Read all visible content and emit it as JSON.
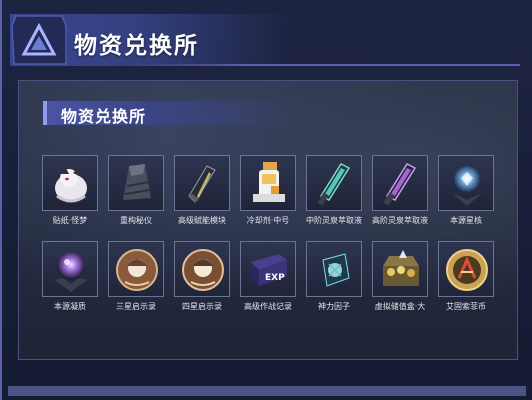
{
  "header": {
    "title": "物资兑换所"
  },
  "panel": {
    "title": "物资兑换所"
  },
  "items_row1": [
    {
      "label": "贴纸·怪梦",
      "icon": "sticker-girl-icon"
    },
    {
      "label": "重构秘仪",
      "icon": "folded-cloth-icon"
    },
    {
      "label": "高级赋能模块",
      "icon": "dark-crystal-module-icon"
    },
    {
      "label": "冷却剂·中号",
      "icon": "coolant-bottle-icon"
    },
    {
      "label": "中阶灵泉萃取液",
      "icon": "teal-vial-icon"
    },
    {
      "label": "高阶灵泉萃取液",
      "icon": "purple-vial-icon"
    },
    {
      "label": "本源星核",
      "icon": "star-core-orb-icon"
    }
  ],
  "items_row2": [
    {
      "label": "本源凝质",
      "icon": "essence-orb-icon"
    },
    {
      "label": "三星启示录",
      "icon": "three-star-record-icon"
    },
    {
      "label": "四星启示录",
      "icon": "four-star-record-icon"
    },
    {
      "label": "高级作战记录",
      "icon": "exp-record-icon"
    },
    {
      "label": "神力因子",
      "icon": "divine-factor-icon"
    },
    {
      "label": "虚拟储值盒·大",
      "icon": "treasure-box-icon"
    },
    {
      "label": "艾固索菲币",
      "icon": "gold-coin-icon"
    }
  ],
  "colors": {
    "accent": "#4a54a4",
    "frame": "#5a62a8",
    "teal_vial": "#5fe0d4",
    "purple_vial": "#b070e0",
    "coin": "#c9a253"
  }
}
